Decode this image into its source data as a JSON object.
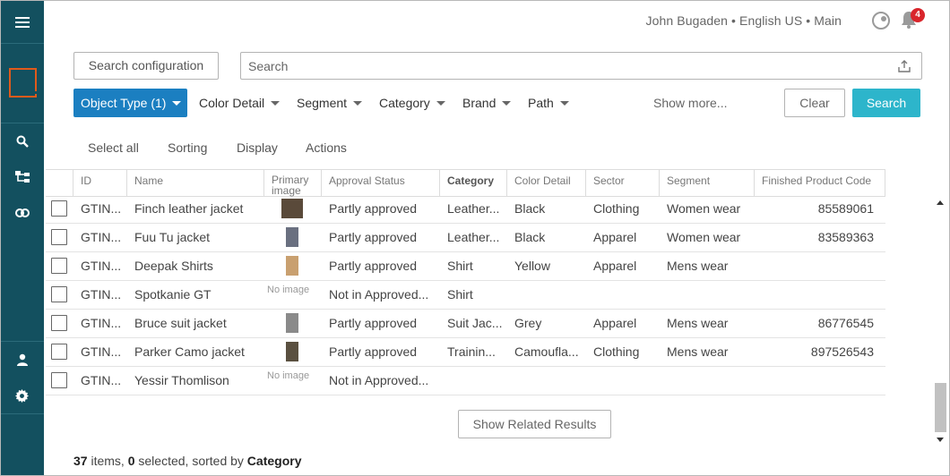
{
  "header": {
    "user_info": "John Bugaden • English US • Main",
    "notification_count": "4"
  },
  "search": {
    "config_label": "Search configuration",
    "placeholder": "Search"
  },
  "filters": {
    "active": "Object Type (1)",
    "items": [
      "Color Detail",
      "Segment",
      "Category",
      "Brand",
      "Path"
    ],
    "show_more": "Show more...",
    "clear_label": "Clear",
    "search_label": "Search"
  },
  "actions": [
    "Select all",
    "Sorting",
    "Display",
    "Actions"
  ],
  "table": {
    "columns": [
      "ID",
      "Name",
      "Primary image",
      "Approval Status",
      "Category",
      "Color Detail",
      "Sector",
      "Segment",
      "Finished Product Code"
    ],
    "sorted_column": "Category",
    "no_image_text": "No image",
    "rows": [
      {
        "id": "GTIN...",
        "name": "Finch leather jacket",
        "image": "thumb",
        "status": "Partly approved",
        "category": "Leather...",
        "color": "Black",
        "sector": "Clothing",
        "segment": "Women wear",
        "code": "85589061"
      },
      {
        "id": "GTIN...",
        "name": "Fuu Tu jacket",
        "image": "thumb",
        "status": "Partly approved",
        "category": "Leather...",
        "color": "Black",
        "sector": "Apparel",
        "segment": "Women wear",
        "code": "83589363"
      },
      {
        "id": "GTIN...",
        "name": "Deepak Shirts",
        "image": "thumb",
        "status": "Partly approved",
        "category": "Shirt",
        "color": "Yellow",
        "sector": "Apparel",
        "segment": "Mens wear",
        "code": ""
      },
      {
        "id": "GTIN...",
        "name": "Spotkanie GT",
        "image": "none",
        "status": "Not in Approved...",
        "category": "Shirt",
        "color": "",
        "sector": "",
        "segment": "",
        "code": ""
      },
      {
        "id": "GTIN...",
        "name": "Bruce suit jacket",
        "image": "thumb",
        "status": "Partly approved",
        "category": "Suit Jac...",
        "color": "Grey",
        "sector": "Apparel",
        "segment": "Mens wear",
        "code": "86776545"
      },
      {
        "id": "GTIN...",
        "name": "Parker Camo jacket",
        "image": "thumb",
        "status": "Partly approved",
        "category": "Trainin...",
        "color": "Camoufla...",
        "sector": "Clothing",
        "segment": "Mens wear",
        "code": "897526543"
      },
      {
        "id": "GTIN...",
        "name": "Yessir Thomlison",
        "image": "none",
        "status": "Not in Approved...",
        "category": "",
        "color": "",
        "sector": "",
        "segment": "",
        "code": ""
      }
    ]
  },
  "footer": {
    "related_label": "Show Related Results",
    "count": "37",
    "items_text": " items, ",
    "selected": "0",
    "selected_text": " selected, sorted by ",
    "sorted_by": "Category"
  },
  "icons": [
    "menu-icon",
    "logo-icon",
    "search-icon",
    "hierarchy-icon",
    "link-icon",
    "user-icon",
    "gear-icon",
    "theme-icon",
    "bell-icon",
    "export-icon"
  ],
  "colors": {
    "sidebar": "#13505f",
    "primary": "#1b7fc1",
    "search_button": "#2db5cb",
    "logo": "#e05a1b",
    "badge": "#d9262c"
  }
}
